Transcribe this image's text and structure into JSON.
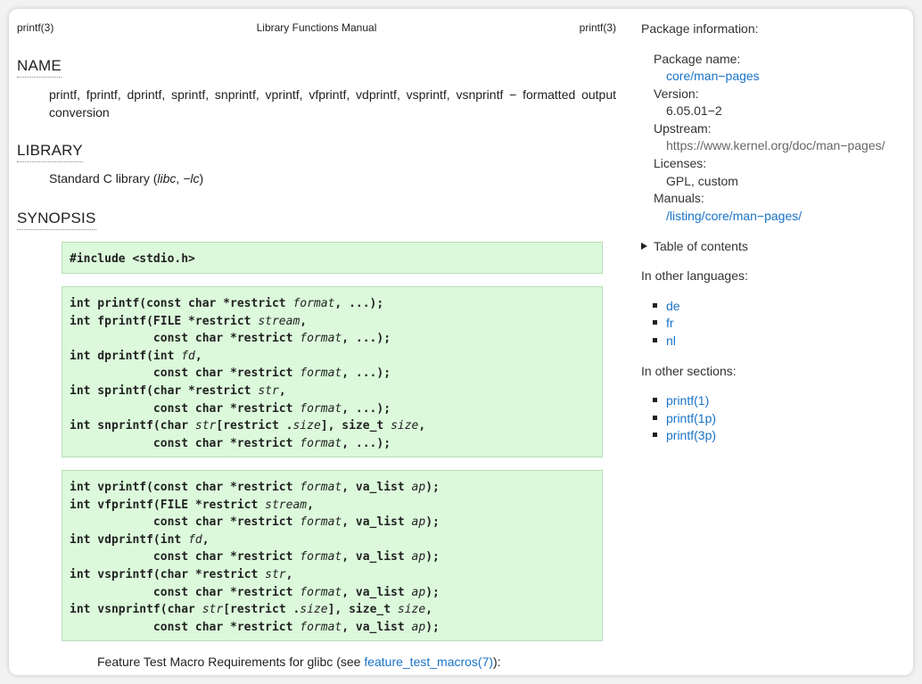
{
  "header": {
    "left": "printf(3)",
    "center": "Library Functions Manual",
    "right": "printf(3)"
  },
  "sections": {
    "name": {
      "heading": "NAME",
      "text": "printf, fprintf, dprintf, sprintf, snprintf, vprintf, vfprintf, vdprintf, vsprintf, vsnprintf − formatted output conversion"
    },
    "library": {
      "heading": "LIBRARY",
      "prefix": "Standard C library (",
      "libc": "libc",
      "comma": ", ",
      "lc": "−lc",
      "suffix": ")"
    },
    "synopsis": {
      "heading": "SYNOPSIS",
      "include": "#include <stdio.h>",
      "ftm_prefix": "Feature Test Macro Requirements for glibc (see ",
      "ftm_link": "feature_test_macros(7)",
      "ftm_suffix": "):"
    }
  },
  "sidebar": {
    "package_info_title": "Package information:",
    "package_name_label": "Package name:",
    "package_name_value": "core/man−pages",
    "version_label": "Version:",
    "version_value": "6.05.01−2",
    "upstream_label": "Upstream:",
    "upstream_value": "https://www.kernel.org/doc/man−pages/",
    "licenses_label": "Licenses:",
    "licenses_value": "GPL, custom",
    "manuals_label": "Manuals:",
    "manuals_value": "/listing/core/man−pages/",
    "toc_label": "Table of contents",
    "other_languages_title": "In other languages:",
    "languages": [
      "de",
      "fr",
      "nl"
    ],
    "other_sections_title": "In other sections:",
    "sections": [
      "printf(1)",
      "printf(1p)",
      "printf(3p)"
    ]
  },
  "colors": {
    "link": "#1a73c8",
    "code_bg": "#dcf9dc",
    "code_border": "#b8dcb8"
  }
}
